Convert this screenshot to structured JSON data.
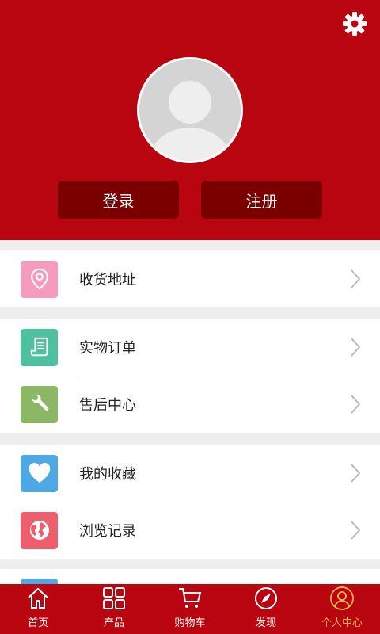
{
  "colors": {
    "brand": "#b8050f",
    "button_dark": "#7a0000",
    "tab_active": "#ffb84a"
  },
  "header": {
    "settings_icon": "gear-icon",
    "avatar_icon": "default-avatar-icon"
  },
  "auth": {
    "login_label": "登录",
    "register_label": "注册"
  },
  "menu": {
    "address": {
      "label": "收货地址",
      "icon": "location-pin-icon",
      "color": "#f59bbd"
    },
    "orders": {
      "label": "实物订单",
      "icon": "receipt-icon",
      "color": "#4fc0a0"
    },
    "aftersales": {
      "label": "售后中心",
      "icon": "wrench-icon",
      "color": "#8cb865"
    },
    "favorites": {
      "label": "我的收藏",
      "icon": "heart-icon",
      "color": "#4ea8e4"
    },
    "history": {
      "label": "浏览记录",
      "icon": "globe-icon",
      "color": "#ec5f6d"
    }
  },
  "tabs": [
    {
      "label": "首页",
      "icon": "home-icon"
    },
    {
      "label": "产品",
      "icon": "grid-icon"
    },
    {
      "label": "购物车",
      "icon": "cart-icon"
    },
    {
      "label": "发现",
      "icon": "compass-icon"
    },
    {
      "label": "个人中心",
      "icon": "user-icon",
      "active": true
    }
  ]
}
